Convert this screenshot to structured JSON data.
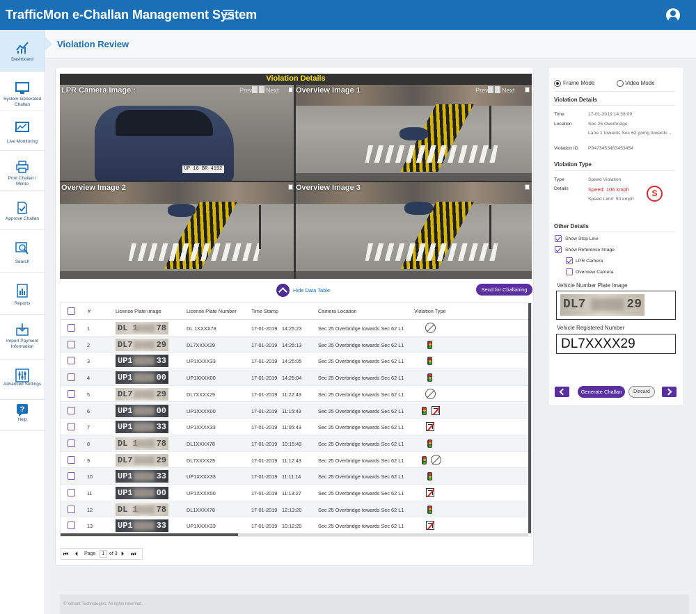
{
  "app": {
    "title": "TrafficMon e-Challan Management System"
  },
  "sidebar": {
    "items": [
      {
        "label": "Dashboard",
        "icon": "chart-icon"
      },
      {
        "label": "System Generated Challan",
        "icon": "monitor-icon"
      },
      {
        "label": "Live Monitoring",
        "icon": "live-chart-icon"
      },
      {
        "label": "Print Challan / Memo",
        "icon": "printer-icon"
      },
      {
        "label": "Approve Challan",
        "icon": "approve-document-icon"
      },
      {
        "label": "Search",
        "icon": "search-icon"
      },
      {
        "label": "Reports",
        "icon": "report-icon"
      },
      {
        "label": "Import Payment Information",
        "icon": "import-icon"
      },
      {
        "label": "Advanced Settings",
        "icon": "sliders-icon"
      },
      {
        "label": "Help",
        "icon": "help-icon"
      }
    ]
  },
  "page": {
    "title": "Violation Review"
  },
  "viewer": {
    "title": "Violation Details",
    "lpr_label": "LPR Camera Image :",
    "overview1_label": "Overview Image 1",
    "overview2_label": "Overview Image 2",
    "overview3_label": "Overview Image 3",
    "prev": "Prev",
    "next": "Next",
    "lpr_plate_text": "UP 16 BR 4192"
  },
  "actions": {
    "hide_table": "Hide Data Table",
    "send_challan": "Send for Challaning"
  },
  "table": {
    "headers": [
      "#",
      "License Plate image",
      "License Plate Number",
      "Time Stamp",
      "Camera Location",
      "Violation Type"
    ],
    "rows": [
      {
        "num": "1",
        "plate_l": "DL 1",
        "plate_r": "78",
        "plate_style": "light",
        "number": "DL 1XXXX78",
        "date": "17-01-2019",
        "time": "14:25:23",
        "location": "Sec 25 Overbridge towards Sec 62 L1",
        "violations": [
          "no-u-turn"
        ]
      },
      {
        "num": "2",
        "plate_l": "DL7",
        "plate_r": "29",
        "plate_style": "light",
        "number": "DL7XXXX29",
        "date": "17-01-2019",
        "time": "14:25:13",
        "location": "Sec 25 Overbridge towards Sec 62 L1",
        "violations": [
          "red-light"
        ]
      },
      {
        "num": "3",
        "plate_l": "UP1",
        "plate_r": "33",
        "plate_style": "dark",
        "number": "UP1XXXX33",
        "date": "17-01-2019",
        "time": "14:25:05",
        "location": "Sec 25 Overbridge towards Sec 62 L1",
        "violations": [
          "red-light"
        ]
      },
      {
        "num": "4",
        "plate_l": "UP1",
        "plate_r": "00",
        "plate_style": "dark",
        "number": "UP1XXXX00",
        "date": "17-01-2019",
        "time": "14:25:04",
        "location": "Sec 25 Overbridge towards Sec 62 L1",
        "violations": [
          "red-light"
        ]
      },
      {
        "num": "5",
        "plate_l": "DL7",
        "plate_r": "29",
        "plate_style": "light",
        "number": "DL7XXXX29",
        "date": "17-01-2019",
        "time": "11:22:43",
        "location": "Sec 25 Overbridge towards Sec 62 L1",
        "violations": [
          "no-u-turn"
        ]
      },
      {
        "num": "6",
        "plate_l": "UP1",
        "plate_r": "00",
        "plate_style": "dark",
        "number": "UP1XXXX00",
        "date": "17-01-2019",
        "time": "11:15:43",
        "location": "Sec 25 Overbridge towards Sec 62 L1",
        "violations": [
          "red-light",
          "no-right-turn"
        ]
      },
      {
        "num": "7",
        "plate_l": "UP1",
        "plate_r": "33",
        "plate_style": "dark",
        "number": "UP1XXXX33",
        "date": "17-01-2019",
        "time": "11:05:43",
        "location": "Sec 25 Overbridge towards Sec 62 L1",
        "violations": [
          "no-right-turn"
        ]
      },
      {
        "num": "8",
        "plate_l": "DL 1",
        "plate_r": "78",
        "plate_style": "light",
        "number": "DL1XXXX78",
        "date": "17-01-2019",
        "time": "10:15:43",
        "location": "Sec 25 Overbridge towards Sec 62 L1",
        "violations": [
          "red-light"
        ]
      },
      {
        "num": "9",
        "plate_l": "DL7",
        "plate_r": "29",
        "plate_style": "light",
        "number": "DL7XXXX29",
        "date": "17-01-2019",
        "time": "11:12:43",
        "location": "Sec 25 Overbridge towards Sec 62 L1",
        "violations": [
          "red-light",
          "no-u-turn"
        ]
      },
      {
        "num": "10",
        "plate_l": "UP1",
        "plate_r": "33",
        "plate_style": "dark",
        "number": "UP1XXXX33",
        "date": "17-01-2019",
        "time": "11:11:14",
        "location": "Sec 25 Overbridge towards Sec 62 L1",
        "violations": [
          "red-light"
        ]
      },
      {
        "num": "11",
        "plate_l": "UP1",
        "plate_r": "00",
        "plate_style": "dark",
        "number": "UP1XXXX00",
        "date": "17-01-2019",
        "time": "11:13:27",
        "location": "Sec 25 Overbridge towards Sec 62 L1",
        "violations": [
          "no-right-turn"
        ]
      },
      {
        "num": "12",
        "plate_l": "DL 1",
        "plate_r": "78",
        "plate_style": "light",
        "number": "DL1XXXX78",
        "date": "17-01-2019",
        "time": "12:13:20",
        "location": "Sec 25 Overbridge towards Sec 62 L1",
        "violations": [
          "red-light"
        ]
      },
      {
        "num": "13",
        "plate_l": "UP1",
        "plate_r": "33",
        "plate_style": "dark",
        "number": "UP1XXXX33",
        "date": "17-01-2019",
        "time": "10:12:20",
        "location": "Sec 25 Overbridge towards Sec 62 L1",
        "violations": [
          "no-right-turn"
        ]
      }
    ]
  },
  "pager": {
    "page_label": "Page",
    "current": "1",
    "of_label": "of 3"
  },
  "details": {
    "frame_mode": "Frame Mode",
    "video_mode": "Video Mode",
    "violation_details_title": "Violation Details",
    "time_key": "Time",
    "time_val": "17-01-2019   14:39:09",
    "location_key": "Location",
    "location_val1": "Sec 25 Overbridge",
    "location_val2": "Lane 1 towards Sec 62 going towards ...",
    "violation_id_key": "Violation ID",
    "violation_id_val": "P9473453453453454",
    "violation_type_title": "Violation Type",
    "type_key": "Type",
    "type_val": "Speed Violation",
    "details_key": "Details",
    "speed_val": "Speed: 106 kmph",
    "limit_val": "Speed Limit: 90 kmph",
    "speed_badge": "S",
    "other_title": "Other Details",
    "show_stop_line": "Show Stop Line",
    "show_reference": "Show Reference Image",
    "lpr_camera": "LPR Camera",
    "overview_camera": "Overview Camera",
    "plate_image_title": "Vehicle Number Plate Image",
    "plate_image_l": "DL7",
    "plate_image_r": "29",
    "registered_title": "Vehicle Registered Number",
    "registered_val": "DL7XXXX29",
    "generate": "Generate Challan",
    "discard": "Discard"
  },
  "footer": {
    "text": "© Vehant Technologies. All rights reserved."
  },
  "colors": {
    "topbar": "#1b6fb5",
    "accent_purple": "#5a2fa0",
    "speed_red": "#d92b2b",
    "title_yellow": "#f5e200"
  }
}
